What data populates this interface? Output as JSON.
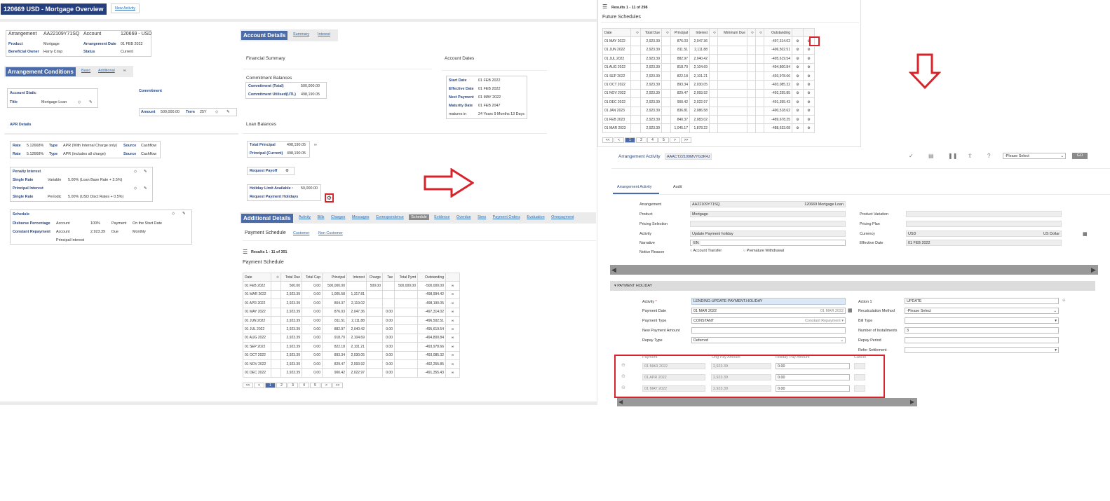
{
  "header": {
    "title": "120669 USD - Mortgage Overview",
    "new_activity": "New Activity"
  },
  "arr": {
    "arrangement_label": "Arrangement",
    "arrangement_value": "AA22109Y71SQ",
    "account_label": "Account",
    "account_value": "120669 - USD",
    "product_label": "Product",
    "product_value": "Mortgage",
    "arr_date_label": "Arrangement Date",
    "arr_date_value": "01 FEB 2022",
    "owner_label": "Beneficial Owner",
    "owner_value": "Harry Crisp",
    "status_label": "Status",
    "status_value": "Current"
  },
  "cond": {
    "title": "Arrangement Conditions",
    "tab_basic": "Basic",
    "tab_additional": "Additional",
    "account_static": "Account Static",
    "title_label": "Title",
    "title_value": "Mortgage Loan",
    "commitment": "Commitment",
    "amount_label": "Amount",
    "amount_value": "500,000.00",
    "term_label": "Term",
    "term_value": "25Y",
    "apr_details": "APR Details",
    "apr_rows": [
      {
        "rate_label": "Rate",
        "rate": "5.12668%",
        "type_label": "Type",
        "type": "APR (With Internal Charge only)",
        "source_label": "Source",
        "source": "Cashflow"
      },
      {
        "rate_label": "Rate",
        "rate": "5.12668%",
        "type_label": "Type",
        "type": "APR (includes all charge)",
        "source_label": "Source",
        "source": "Cashflow"
      }
    ],
    "penalty": "Penalty Interest",
    "single_rate": "Single Rate",
    "variable": "Variable",
    "penalty_value": "5.00% (Loan Base Rate + 3.5%)",
    "principal_interest": "Principal Interest",
    "periodic": "Periodic",
    "principal_value": "5.00% (USD Disct Rates + 0.5%)",
    "schedule": "Schedule",
    "disburse": "Disburse Percentage",
    "account": "Account",
    "pct": "100%",
    "payment": "Payment",
    "on_start": "On the Start Date",
    "constant": "Constant Repayment",
    "amount2": "2,923.39",
    "due": "Due",
    "monthly": "Monthly",
    "principal_int": "Principal Interest"
  },
  "acct": {
    "title": "Account Details",
    "tab_summary": "Summary",
    "tab_interest": "Interest",
    "fin_summary": "Financial Summary",
    "account_dates": "Account Dates",
    "commit_bal": "Commitment Balances",
    "commit_total_label": "Commitment (Total)",
    "commit_total": "500,000.00",
    "commit_util_label": "Commitment Utilised(UTL)",
    "commit_util": "498,190.05",
    "start_label": "Start Date",
    "start": "01 FEB 2022",
    "eff_label": "Effective Date",
    "eff": "01 FEB 2022",
    "next_label": "Next Payment",
    "next": "01 MAY 2022",
    "mat_label": "Maturity Date",
    "mat": "01 FEB 2047",
    "matures_label": "matures in",
    "matures": "24 Years 9 Months 13 Days",
    "loan_bal": "Loan Balances",
    "tot_princ_label": "Total Principal",
    "tot_princ": "498,190.05",
    "cur_princ_label": "Principal (Current)",
    "cur_princ": "498,190.05",
    "payoff": "Request Payoff",
    "holiday_limit_label": "Holiday Limit Available :",
    "holiday_limit": "50,000.00",
    "req_holiday": "Request Payment Holidays"
  },
  "addl": {
    "title": "Additional Details",
    "tabs": [
      "Activity",
      "Bills",
      "Charges",
      "Messages",
      "Correspondence",
      "Schedule",
      "Evidence",
      "Overdue",
      "Sims",
      "Payment Orders",
      "Evaluation",
      "Overpayment"
    ],
    "pay_sched": "Payment Schedule",
    "customer": "Customer",
    "non_customer": "Non Customer",
    "results": "Results 1 - 11 of 301",
    "sched_title": "Payment Schedule",
    "cols": [
      "Date",
      "Total Due",
      "Total Cap",
      "Principal",
      "Interest",
      "Charge",
      "Tax",
      "Total Pymt",
      "Outstanding"
    ],
    "rows": [
      [
        "01 FEB 2022",
        "500.00",
        "0.00",
        "500,000.00",
        "",
        "500.00",
        "",
        "500,000.00",
        "-500,000.00"
      ],
      [
        "01 MAR 2022",
        "2,923.39",
        "0.00",
        "1,005.58",
        "1,317.81",
        "",
        "",
        "",
        "-498,994.42"
      ],
      [
        "01 APR 2022",
        "2,923.39",
        "0.00",
        "804.37",
        "2,119.02",
        "",
        "",
        "",
        "-498,190.05"
      ],
      [
        "01 MAY 2022",
        "2,923.39",
        "0.00",
        "876.03",
        "2,047.36",
        "",
        "0.00",
        "",
        "-497,314.02"
      ],
      [
        "01 JUN 2022",
        "2,923.39",
        "0.00",
        "811.51",
        "2,111.88",
        "",
        "0.00",
        "",
        "-496,502.51"
      ],
      [
        "01 JUL 2022",
        "2,923.39",
        "0.00",
        "882.97",
        "2,040.42",
        "",
        "0.00",
        "",
        "-495,619.54"
      ],
      [
        "01 AUG 2022",
        "2,923.39",
        "0.00",
        "918.70",
        "2,104.69",
        "",
        "0.00",
        "",
        "-494,800.84"
      ],
      [
        "01 SEP 2022",
        "2,923.39",
        "0.00",
        "822.18",
        "2,101.21",
        "",
        "0.00",
        "",
        "-493,978.66"
      ],
      [
        "01 OCT 2022",
        "2,923.39",
        "0.00",
        "893.34",
        "2,030.05",
        "",
        "0.00",
        "",
        "-493,085.32"
      ],
      [
        "01 NOV 2022",
        "2,923.39",
        "0.00",
        "829.47",
        "2,093.92",
        "",
        "0.00",
        "",
        "-492,255.85"
      ],
      [
        "01 DEC 2022",
        "2,923.39",
        "0.00",
        "900.42",
        "2,022.97",
        "",
        "0.00",
        "",
        "-491,355.43"
      ]
    ],
    "pages": [
      "<<",
      "<",
      "1",
      "2",
      "3",
      "4",
      "5",
      ">",
      ">>"
    ]
  },
  "future": {
    "results": "Results 1 - 11 of 298",
    "title": "Future Schedules",
    "cols": [
      "Date",
      "Total Due",
      "Principal",
      "Interest",
      "Minimum Due",
      "Outstanding"
    ],
    "rows": [
      [
        "01 MAY 2022",
        "2,923.39",
        "876.03",
        "2,047.36",
        "",
        "-497,314.02"
      ],
      [
        "01 JUN 2022",
        "2,923.39",
        "811.51",
        "2,111.88",
        "",
        "-496,502.51"
      ],
      [
        "01 JUL 2022",
        "2,923.39",
        "882.97",
        "2,040.42",
        "",
        "-495,619.54"
      ],
      [
        "01 AUG 2022",
        "2,923.39",
        "818.70",
        "2,104.69",
        "",
        "-494,800.84"
      ],
      [
        "01 SEP 2022",
        "2,923.39",
        "822.18",
        "2,101.21",
        "",
        "-493,978.66"
      ],
      [
        "01 OCT 2022",
        "2,923.39",
        "893.34",
        "2,030.05",
        "",
        "-493,085.32"
      ],
      [
        "01 NOV 2022",
        "2,923.39",
        "829.47",
        "2,093.92",
        "",
        "-492,255.85"
      ],
      [
        "01 DEC 2022",
        "2,923.39",
        "900.42",
        "2,022.97",
        "",
        "-491,355.43"
      ],
      [
        "01 JAN 2023",
        "2,923.39",
        "836.81",
        "2,086.58",
        "",
        "-490,518.62"
      ],
      [
        "01 FEB 2023",
        "2,923.39",
        "840.37",
        "2,083.02",
        "",
        "-489,678.25"
      ],
      [
        "01 MAR 2023",
        "2,923.39",
        "1,045.17",
        "1,878.22",
        "",
        "-488,633.08"
      ]
    ],
    "pages": [
      "<<",
      "<",
      "1",
      "2",
      "4",
      "5",
      ">",
      ">>"
    ]
  },
  "activity": {
    "label": "Arrangement Activity",
    "id": "AAACT22109MVYG3R4J",
    "select": "-Please Select",
    "go": "GO",
    "tab_activity": "Arrangement Activity",
    "tab_audit": "Audit",
    "arrangement_label": "Arrangement",
    "arrangement": "AA22109Y71SQ",
    "arr_desc": "120669 Mortgage Loan",
    "product_label": "Product",
    "product": "Mortgage",
    "pricing_label": "Pricing Selection",
    "activity_label": "Activity",
    "activity": "Update Payment holiday",
    "narrative_label": "Narrative",
    "narrative": "EN",
    "notice_label": "Notice Reason",
    "notice_opt1": "Account Transfer",
    "notice_opt2": "Premature Withdrawal",
    "prod_var_label": "Product Variation",
    "pricing_plan_label": "Pricing Plan",
    "currency_label": "Currency",
    "currency": "USD",
    "currency_desc": "US Dollar",
    "effdate_label": "Effective Date",
    "effdate": "01 FEB 2022",
    "section": "PAYMENT HOLIDAY",
    "act_label": "Activity",
    "act_value": "LENDING-UPDATE-PAYMENT.HOLIDAY",
    "paydate_label": "Payment Date",
    "paydate": "01 MAR 2022",
    "paydate_hint": "01 MAR 2022",
    "paytype_label": "Payment Type",
    "paytype": "CONSTANT",
    "paytype_hint": "Constant Repayment",
    "newpay_label": "New Payment Amount",
    "repay_label": "Repay Type",
    "repay": "Deferred",
    "action_label": "Action 1",
    "action": "UPDATE",
    "recalc_label": "Recalculation Method",
    "recalc": "-Please Select",
    "bill_label": "Bill Type",
    "ninst_label": "Number of Installments",
    "ninst": "3",
    "repay_period_label": "Repay Period",
    "refer_label": "Refer Settlement",
    "hol_cols": [
      "Payment",
      "Orig Pay Amount",
      "Holiday Pay Amount",
      "Cancel"
    ],
    "hol_rows": [
      [
        "01 MAR 2022",
        "2,923.39",
        "0.00"
      ],
      [
        "01 APR 2022",
        "2,923.39",
        "0.00"
      ],
      [
        "01 MAY 2022",
        "2,923.39",
        "0.00"
      ]
    ]
  },
  "colors": {
    "accent": "#4a6aa8",
    "annotation": "#d8232a"
  }
}
